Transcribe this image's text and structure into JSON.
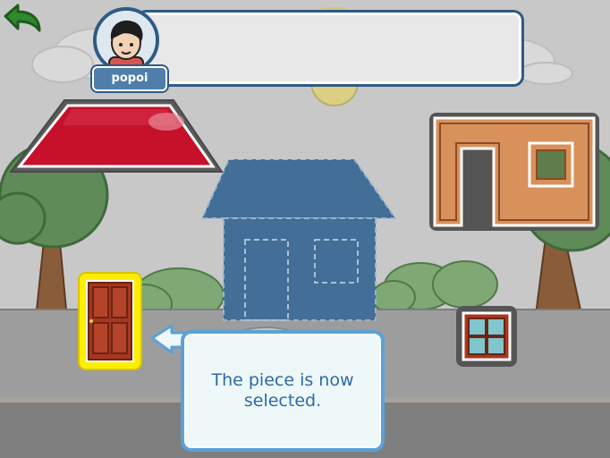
{
  "player": {
    "name": "popoi"
  },
  "speech": {
    "text": ""
  },
  "tip": {
    "message": "The piece is now selected."
  },
  "pieces": [
    {
      "name": "roof",
      "selected": false
    },
    {
      "name": "wall",
      "selected": false
    },
    {
      "name": "window",
      "selected": false
    },
    {
      "name": "door",
      "selected": true
    }
  ],
  "colors": {
    "sky": "#c9c9c9",
    "grass": "#9c9c9c",
    "roof": "#c6112b",
    "wall": "#d8915a",
    "door": "#a8361e",
    "selection": "#ffee00",
    "target": "#436e97",
    "tip_border": "#5aa1d7",
    "ui_border": "#2e5b86"
  }
}
